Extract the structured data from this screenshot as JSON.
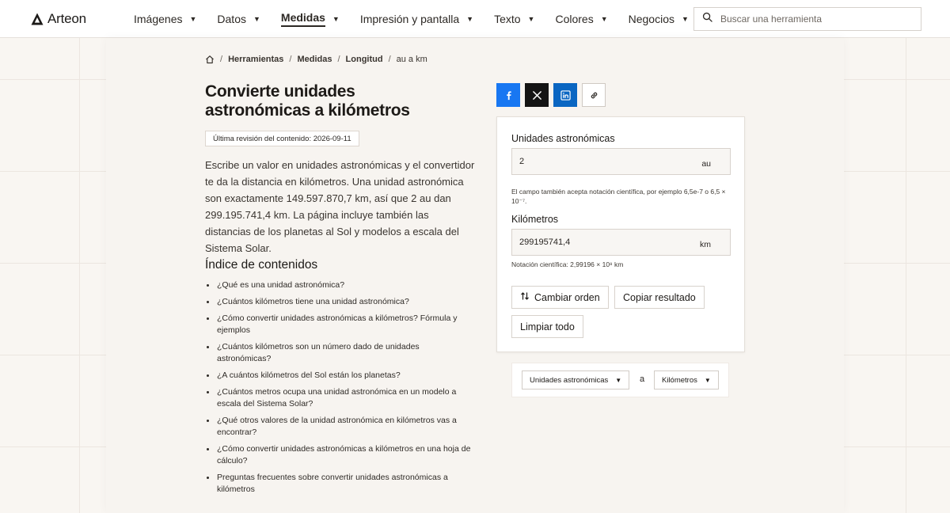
{
  "brand": {
    "name": "Arteon"
  },
  "nav": {
    "items": [
      {
        "label": "Imágenes",
        "active": false
      },
      {
        "label": "Datos",
        "active": false
      },
      {
        "label": "Medidas",
        "active": true
      },
      {
        "label": "Impresión y pantalla",
        "active": false
      },
      {
        "label": "Texto",
        "active": false
      },
      {
        "label": "Colores",
        "active": false
      },
      {
        "label": "Negocios",
        "active": false
      }
    ]
  },
  "search": {
    "placeholder": "Buscar una herramienta",
    "value": ""
  },
  "breadcrumb": {
    "items": [
      "Herramientas",
      "Medidas",
      "Longitud"
    ],
    "current": "au a km"
  },
  "page": {
    "title": "Convierte unidades astronómicas a kilómetros",
    "revision": "Última revisión del contenido: 2026-09-11",
    "intro": "Escribe un valor en unidades astronómicas y el convertidor te da la distancia en kilómetros. Una unidad astronómica son exactamente 149.597.870,7 km, así que 2 au dan 299.195.741,4 km. La página incluye también las distancias de los planetas al Sol y modelos a escala del Sistema Solar.",
    "toc_title": "Índice de contenidos",
    "toc": [
      "¿Qué es una unidad astronómica?",
      "¿Cuántos kilómetros tiene una unidad astronómica?",
      "¿Cómo convertir unidades astronómicas a kilómetros? Fórmula y ejemplos",
      "¿Cuántos kilómetros son un número dado de unidades astronómicas?",
      "¿A cuántos kilómetros del Sol están los planetas?",
      "¿Cuántos metros ocupa una unidad astronómica en un modelo a escala del Sistema Solar?",
      "¿Qué otros valores de la unidad astronómica en kilómetros vas a encontrar?",
      "¿Cómo convertir unidades astronómicas a kilómetros en una hoja de cálculo?",
      "Preguntas frecuentes sobre convertir unidades astronómicas a kilómetros"
    ]
  },
  "share": {
    "icons": [
      "facebook-icon",
      "x-icon",
      "linkedin-icon",
      "link-icon"
    ],
    "colors": {
      "facebook": "#1877f2",
      "x": "#141414",
      "linkedin": "#0a66c2"
    }
  },
  "converter": {
    "from": {
      "label": "Unidades astronómicas",
      "value": "2",
      "unit": "au",
      "hint": "El campo también acepta notación científica, por ejemplo 6,5e-7 o 6,5 × 10⁻⁷."
    },
    "to": {
      "label": "Kilómetros",
      "value": "299195741,4",
      "unit": "km",
      "hint": "Notación científica: 2,99196 × 10⁸ km"
    },
    "buttons": {
      "swap": "Cambiar orden",
      "copy": "Copiar resultado",
      "clear": "Limpiar todo"
    }
  },
  "unit_selector": {
    "from": "Unidades astronómicas",
    "connector": "a",
    "to": "Kilómetros"
  }
}
